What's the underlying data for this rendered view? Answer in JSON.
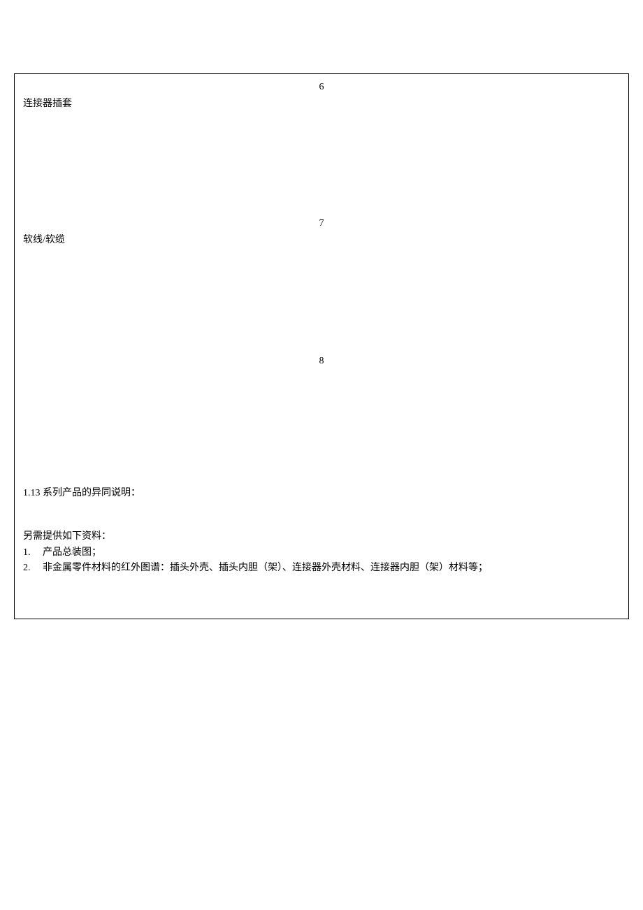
{
  "items": [
    {
      "num": "6",
      "label": "连接器插套"
    },
    {
      "num": "7",
      "label": "软线/软缆"
    },
    {
      "num": "8",
      "label": ""
    }
  ],
  "series": {
    "heading": "1.13 系列产品的异同说明："
  },
  "additional": {
    "heading": "另需提供如下资料：",
    "list": [
      {
        "num": "1.",
        "text": "产品总装图；"
      },
      {
        "num": "2.",
        "text": "非金属零件材料的红外图谱：插头外壳、插头内胆（架）、连接器外壳材料、连接器内胆（架）材料等；"
      }
    ]
  }
}
